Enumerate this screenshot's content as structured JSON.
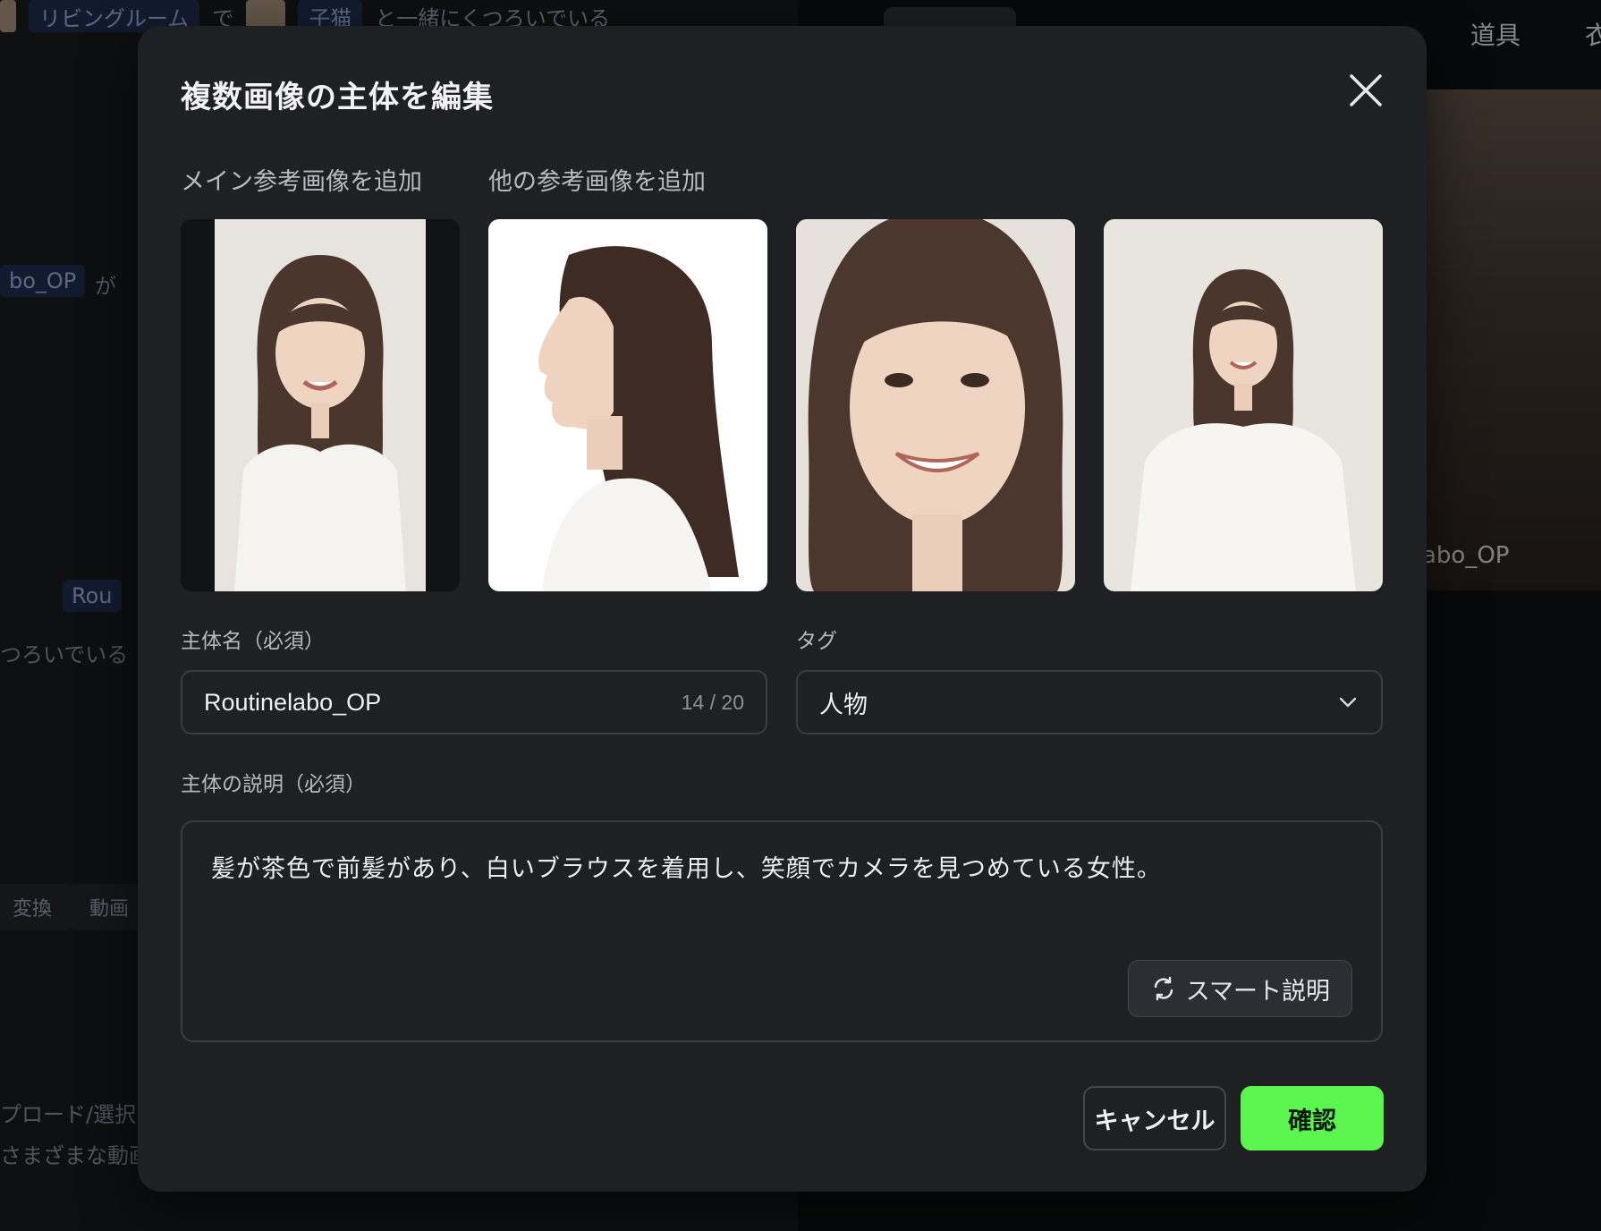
{
  "background": {
    "chip_row": {
      "chip1": "リビングルーム",
      "word1": "で",
      "chip2": "子猫",
      "word2": "と一緒にくつろいでいる"
    },
    "left_text": {
      "chip_partial": "bo_OP",
      "ga": "が",
      "chip_rou": "Rou",
      "line_tsu": "つろいでいる",
      "pill1": "変換",
      "pill2": "動画",
      "upload": "プロード/選択",
      "variety": "さまざまな動画"
    },
    "tabs": [
      "道具",
      "衣"
    ],
    "photo_label": "abo_OP"
  },
  "modal": {
    "title": "複数画像の主体を編集",
    "main_ref_label": "メイン参考画像を追加",
    "other_ref_label": "他の参考画像を追加",
    "name_label": "主体名（必須）",
    "name_value": "Routinelabo_OP",
    "name_count": "14 / 20",
    "tag_label": "タグ",
    "tag_value": "人物",
    "desc_label": "主体の説明（必須）",
    "desc_value": "髪が茶色で前髪があり、白いブラウスを着用し、笑顔でカメラを見つめている女性。",
    "smart_button": "スマート説明",
    "cancel_button": "キャンセル",
    "confirm_button": "確認"
  },
  "colors": {
    "modal_bg": "#1f2024",
    "confirm_green": "#5cf550",
    "border": "#3a3c42"
  },
  "icons": [
    "close-icon",
    "chevron-down-icon",
    "refresh-icon"
  ]
}
